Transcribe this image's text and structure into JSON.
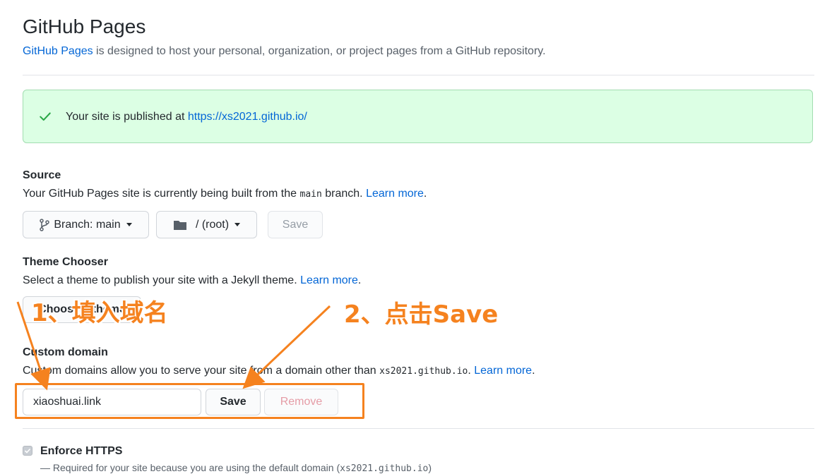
{
  "header": {
    "title": "GitHub Pages",
    "description_link": "GitHub Pages",
    "description_rest": " is designed to host your personal, organization, or project pages from a GitHub repository."
  },
  "flash": {
    "message": "Your site is published at ",
    "url": "https://xs2021.github.io/"
  },
  "source": {
    "title": "Source",
    "desc_before": "Your GitHub Pages site is currently being built from the ",
    "branch_code": "main",
    "desc_after": " branch. ",
    "learn_more": "Learn more",
    "period": ".",
    "branch_button": "Branch: main",
    "folder_button": "/ (root)",
    "save_button": "Save"
  },
  "theme": {
    "title": "Theme Chooser",
    "desc": "Select a theme to publish your site with a Jekyll theme. ",
    "learn_more": "Learn more",
    "period": ".",
    "choose_button": "Choose a theme"
  },
  "custom_domain": {
    "title": "Custom domain",
    "desc_before": "Custom domains allow you to serve your site from a domain other than ",
    "domain_code": "xs2021.github.io",
    "desc_after": ". ",
    "learn_more": "Learn more",
    "period": ".",
    "input_value": "xiaoshuai.link",
    "save_button": "Save",
    "remove_button": "Remove"
  },
  "https": {
    "label": "Enforce HTTPS",
    "note_before": "— Required for your site because you are using the default domain (",
    "note_code": "xs2021.github.io",
    "note_after": ")"
  },
  "annotations": {
    "step1": "1、填入域名",
    "step2": "2、点击Save",
    "color": "#f5821f"
  },
  "colors": {
    "link": "#0366d6",
    "flash_bg": "#dcffe4",
    "success": "#28a745"
  }
}
